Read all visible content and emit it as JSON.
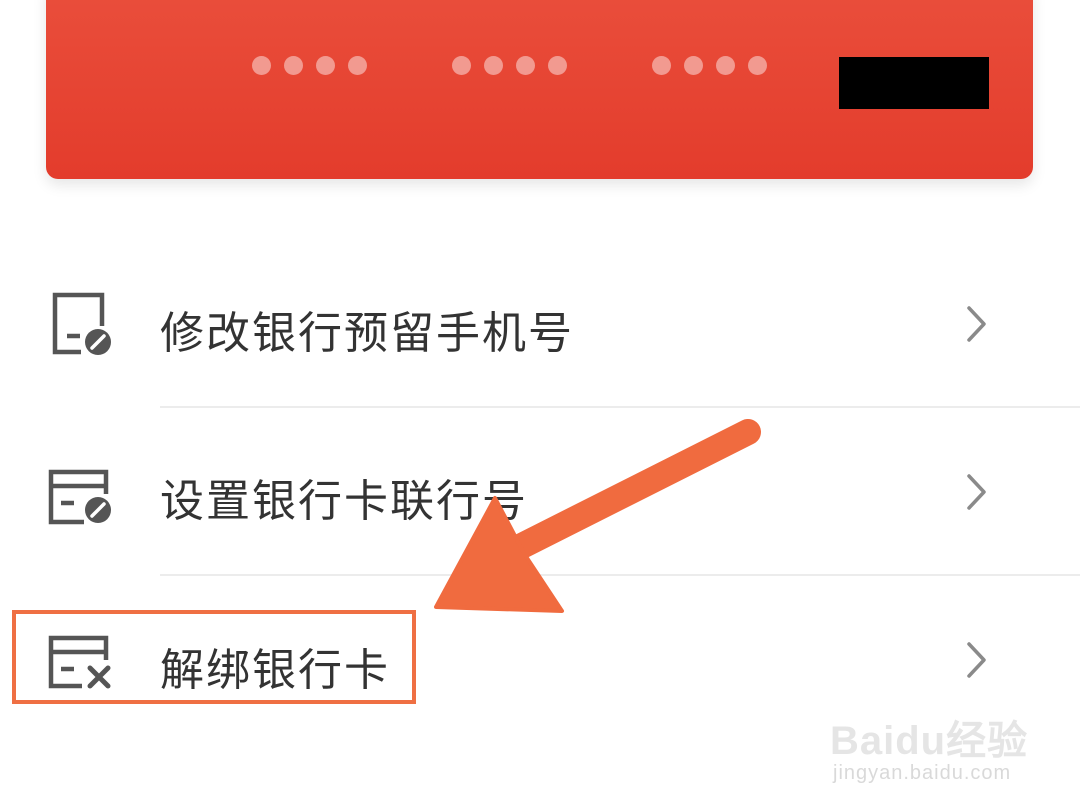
{
  "card": {
    "masked_groups": [
      "••••",
      "••••",
      "••••"
    ],
    "brand_color": "#e6432f"
  },
  "menu": {
    "items": [
      {
        "label": "修改银行预留手机号",
        "icon": "phone-edit-icon"
      },
      {
        "label": "设置银行卡联行号",
        "icon": "card-edit-icon"
      },
      {
        "label": "解绑银行卡",
        "icon": "card-remove-icon"
      }
    ],
    "chevron_icon": "chevron-right-icon"
  },
  "annotation": {
    "highlight_color": "#ef6f43",
    "arrow_color": "#f06b3f"
  },
  "watermark": {
    "brand": "Baidu经验",
    "url": "jingyan.baidu.com"
  }
}
